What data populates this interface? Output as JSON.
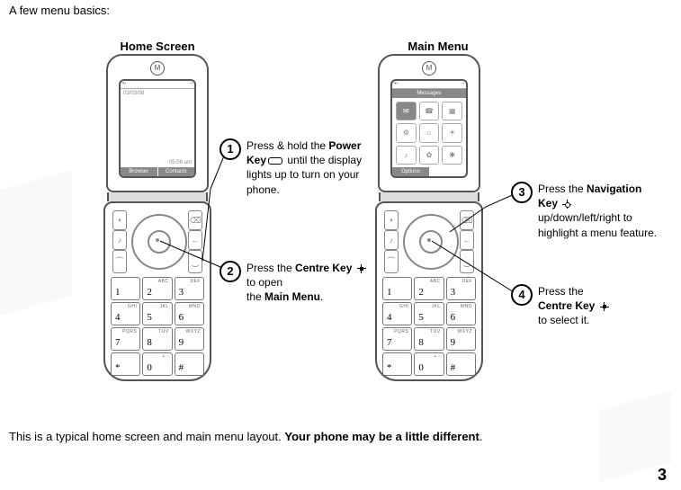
{
  "page": {
    "intro": "A few menu basics:",
    "footer_pre": "This is a typical home screen and main menu layout. ",
    "footer_bold": "Your phone may be a little different",
    "footer_post": ".",
    "number": "3"
  },
  "titles": {
    "home": "Home Screen",
    "menu": "Main Menu"
  },
  "home_screen": {
    "date": "03/03/08",
    "clock": "05:06 am",
    "soft_left": "Browser",
    "soft_right": "Contacts"
  },
  "menu_screen": {
    "title": "Messages",
    "soft": "Options",
    "icons": [
      "✉",
      "☎",
      "▦",
      "⚙",
      "⌂",
      "☀",
      "♪",
      "✿",
      "✱"
    ]
  },
  "keypad": [
    {
      "n": "1",
      "l": ""
    },
    {
      "n": "2",
      "l": "ABC"
    },
    {
      "n": "3",
      "l": "DEF"
    },
    {
      "n": "4",
      "l": "GHI"
    },
    {
      "n": "5",
      "l": "JKL"
    },
    {
      "n": "6",
      "l": "MNO"
    },
    {
      "n": "7",
      "l": "PQRS"
    },
    {
      "n": "8",
      "l": "TUV"
    },
    {
      "n": "9",
      "l": "WXYZ"
    },
    {
      "n": "*",
      "l": ""
    },
    {
      "n": "0",
      "l": "+ -"
    },
    {
      "n": "#",
      "l": ""
    }
  ],
  "nav_icons": {
    "tl": "•",
    "tr": "⌫",
    "ml": "♪",
    "mr": "←",
    "bl": "⏜",
    "br": "⏝"
  },
  "callouts": {
    "c1": {
      "num": "1",
      "pre": "Press & hold the ",
      "b1": "Power Key",
      "mid": " ",
      "post": " until the display lights up to turn on your phone."
    },
    "c2": {
      "num": "2",
      "pre": "Press the ",
      "b1": "Centre Key",
      "mid": " ",
      "post": " to open",
      "line2_pre": "the ",
      "line2_b": "Main Menu",
      "line2_post": "."
    },
    "c3": {
      "num": "3",
      "pre": "Press the ",
      "b1": "Navigation Key",
      "mid": " ",
      "post": " up/down/left/right to highlight a menu feature."
    },
    "c4": {
      "num": "4",
      "pre": "Press the ",
      "b1": "Centre Key",
      "mid": " ",
      "post": " to select it."
    }
  }
}
